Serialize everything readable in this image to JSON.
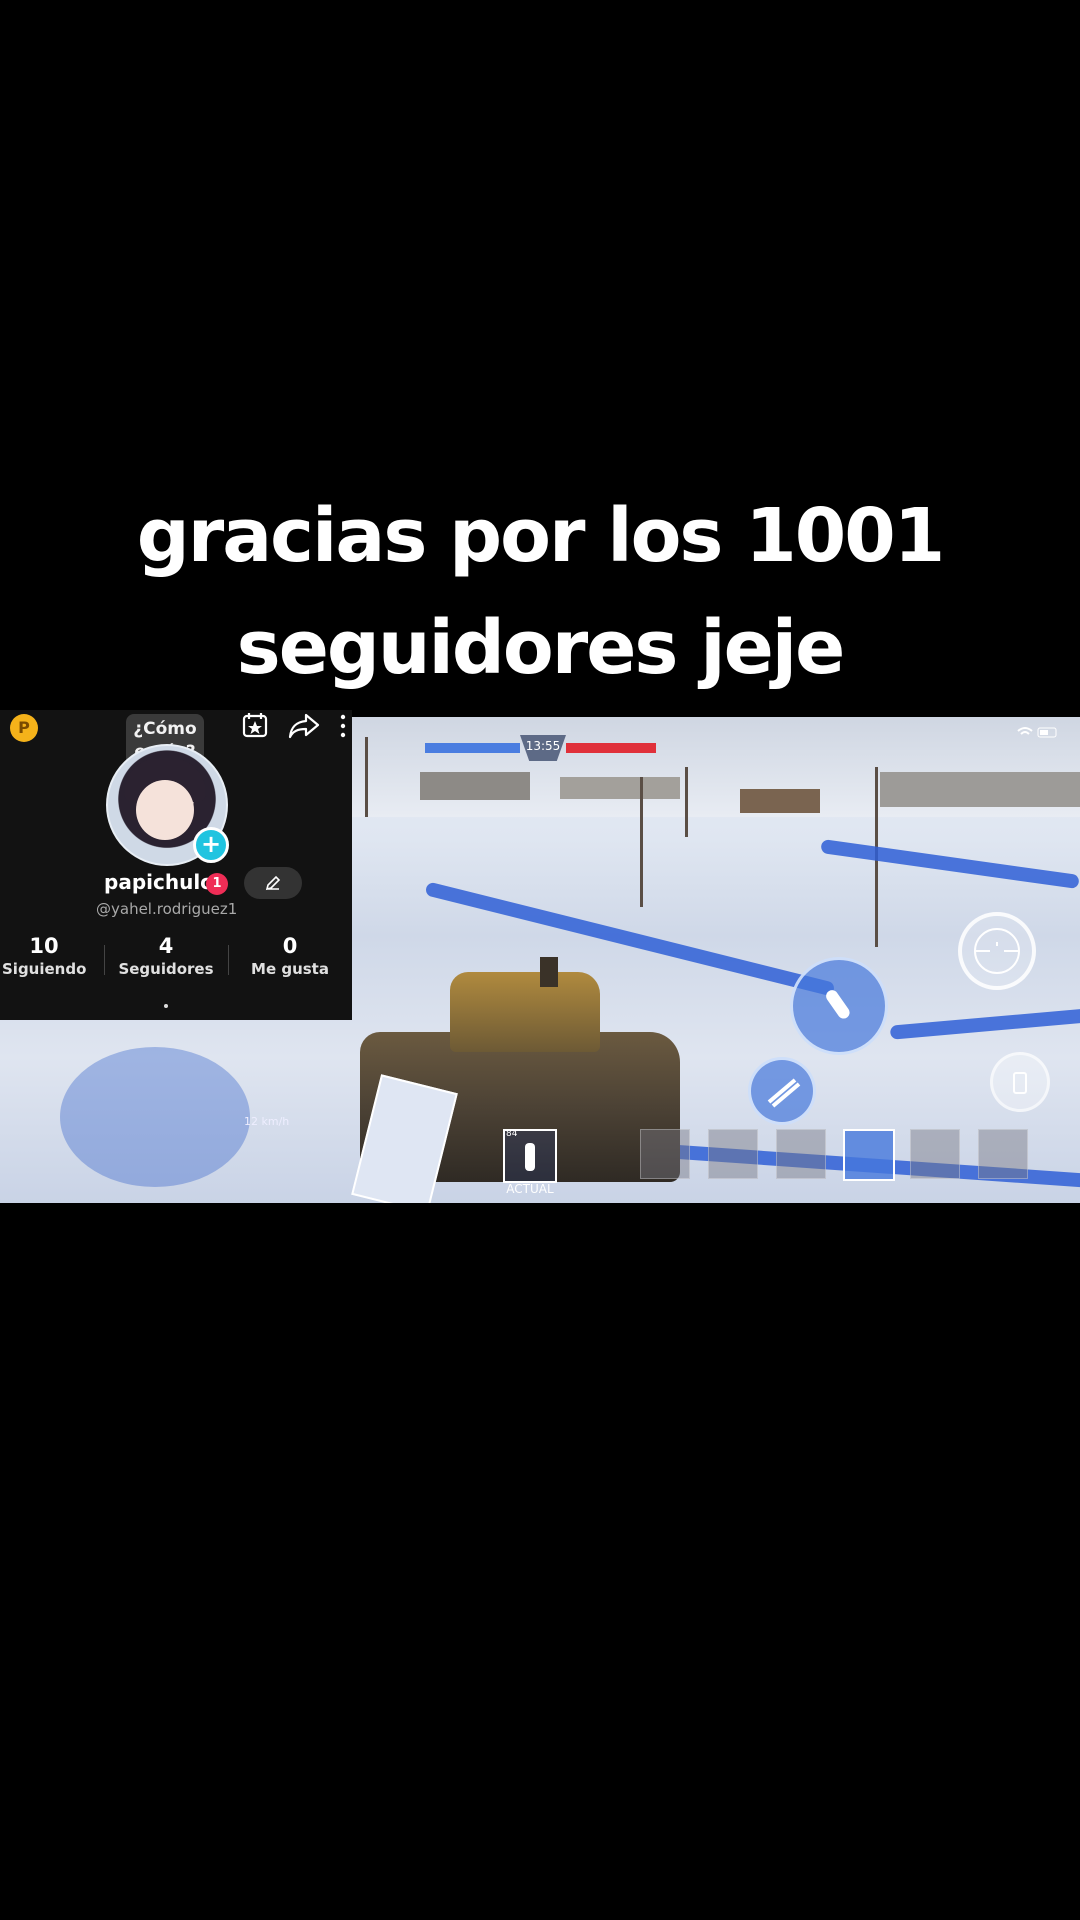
{
  "caption": {
    "line1": "gracias por los 1001",
    "line2": "seguidores jeje"
  },
  "profile": {
    "coin_letter": "P",
    "bubble_line1": "¿Cómo",
    "bubble_line2": "estás?",
    "username": "papichulo",
    "badge_count": "1",
    "handle": "@yahel.rodriguez1",
    "stats": [
      {
        "value": "10",
        "label": "Siguiendo"
      },
      {
        "value": "4",
        "label": "Seguidores"
      },
      {
        "value": "0",
        "label": "Me gusta"
      }
    ],
    "icons": [
      "calendar-star-icon",
      "share-icon",
      "more-icon",
      "pencil-icon",
      "plus-icon"
    ]
  },
  "game": {
    "timer": "13:55",
    "ammo_label": "ACTUAL",
    "ammo_count": "84",
    "speed": "12 km/h",
    "icons": [
      "fire-shell-icon",
      "machine-gun-icon",
      "aim-icon",
      "radio-icon",
      "slot-icons"
    ]
  },
  "colors": {
    "background": "#000000",
    "accent_cyan": "#20c4e0",
    "badge_red": "#ef2d56",
    "coin_yellow": "#f5b21a",
    "team_blue": "#4a7de0",
    "enemy_red": "#e0303a"
  }
}
